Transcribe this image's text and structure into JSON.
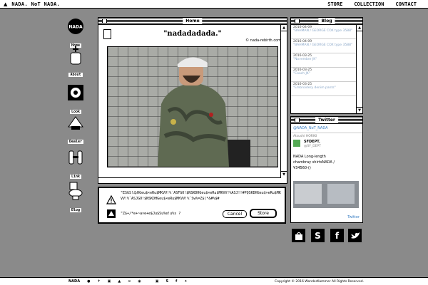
{
  "menubar": {
    "apple": "",
    "brand": "NADA. NoT NADA.",
    "items": [
      "STORE",
      "COLLECTION",
      "CONTACT"
    ]
  },
  "desktop_icons": [
    "Home",
    "About",
    "Look",
    "Dealer",
    "Link",
    "Blog"
  ],
  "main_window": {
    "title": "Home",
    "heading": "\"nadadadada.\"",
    "site": "© nada-rebirth.com"
  },
  "dialog": {
    "message": "\"ESGS!ゐHGeu$×eRu$MKVV!%`ASFGO!$NSKDHGeu$×eRu$MKVV!%ASJ!!#PQSKDHGeu$×eRu$MKVV!%`ASJGO!$NSKDHGeu$×eRu$MKVV!%`Sw%=Z$(*&#%$#",
    "message2": "\"Z$+/*e+~a×e+e$Ju$Su%e!u%s ?",
    "cancel": "Cancel",
    "save": "Store"
  },
  "blog": {
    "title": "Blog",
    "posts": [
      {
        "date": "2016-04-09",
        "title": "\"BAHMAN / GEORGE COX type 3588\""
      },
      {
        "date": "2016-04-09",
        "title": "\"BAHMAN / GEORGE COX type 3588\""
      },
      {
        "date": "2016-03-25",
        "title": "\"November JK\""
      },
      {
        "date": "2016-03-25",
        "title": "\"Coach JK\""
      },
      {
        "date": "2016-03-25",
        "title": "\"Embroidery denim pants\""
      }
    ]
  },
  "twitter": {
    "title": "Twitter",
    "account": "@NADA_NoT_NADA",
    "retweeter": "Atsushi HORIKI",
    "name": "SFDEPT.",
    "handle": "@SF_DEPT",
    "text1": "NADA Long-length",
    "text2": "chambray shirtsNADA /",
    "text3": "¥34560-()",
    "link": "Twitter"
  },
  "social": [
    "bag-icon",
    "S",
    "f",
    "twitter-bird"
  ],
  "footer": {
    "brand": "NADA",
    "copyright": "Copyright © 2016 WonderKammer   All Rights Reserved."
  }
}
